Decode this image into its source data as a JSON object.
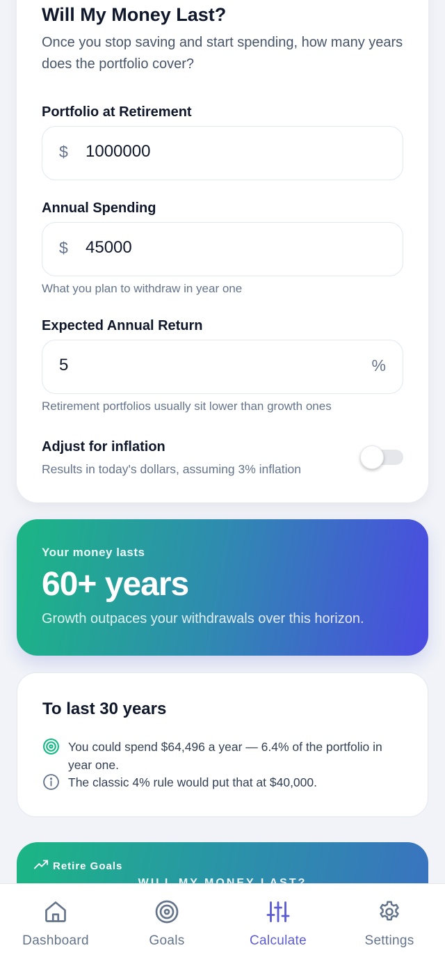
{
  "form": {
    "title": "Will My Money Last?",
    "subtitle": "Once you stop saving and start spending, how many years does the portfolio cover?",
    "portfolio": {
      "label": "Portfolio at Retirement",
      "prefix": "$",
      "value": "1000000"
    },
    "spending": {
      "label": "Annual Spending",
      "prefix": "$",
      "value": "45000",
      "hint": "What you plan to withdraw in year one"
    },
    "return": {
      "label": "Expected Annual Return",
      "value": "5",
      "suffix": "%",
      "hint": "Retirement portfolios usually sit lower than growth ones"
    },
    "inflation": {
      "label": "Adjust for inflation",
      "description": "Results in today's dollars, assuming 3% inflation",
      "enabled": false
    }
  },
  "result": {
    "kicker": "Your money lasts",
    "headline": "60+ years",
    "description": "Growth outpaces your withdrawals over this horizon."
  },
  "last30": {
    "title": "To last 30 years",
    "items": [
      {
        "icon": "target-icon",
        "text": "You could spend $64,496 a year — 6.4% of the portfolio in year one."
      },
      {
        "icon": "info-icon",
        "text": "The classic 4% rule would put that at $40,000."
      }
    ]
  },
  "promo": {
    "brand": "Retire Goals",
    "heading": "WILL MY MONEY LAST?"
  },
  "nav": {
    "items": [
      {
        "label": "Dashboard",
        "icon": "home-icon",
        "active": false
      },
      {
        "label": "Goals",
        "icon": "target-icon",
        "active": false
      },
      {
        "label": "Calculate",
        "icon": "sliders-icon",
        "active": true
      },
      {
        "label": "Settings",
        "icon": "gear-icon",
        "active": false
      }
    ]
  },
  "colors": {
    "accent": "#5b5bd6",
    "gradient_start": "#1bb684",
    "gradient_end": "#4b4ae2",
    "muted": "#64748b"
  }
}
